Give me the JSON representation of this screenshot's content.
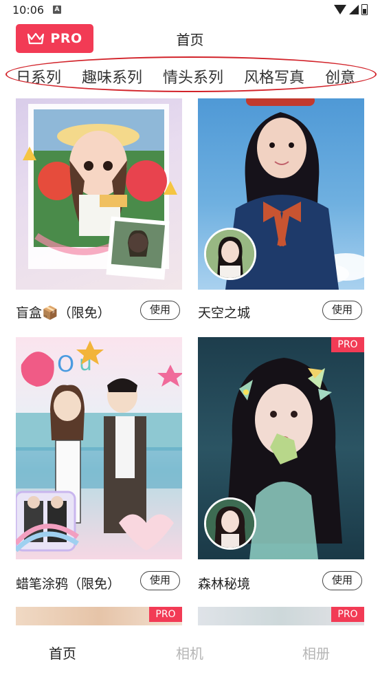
{
  "status": {
    "time": "10:06",
    "notif_icon": "A"
  },
  "header": {
    "pro_label": "PRO",
    "title": "首页"
  },
  "categories": [
    "日系列",
    "趣味系列",
    "情头系列",
    "风格写真",
    "创意"
  ],
  "cards": [
    {
      "title": "盲盒📦（限免）",
      "button": "使用"
    },
    {
      "title": "天空之城",
      "button": "使用"
    },
    {
      "title": "蜡笔涂鸦（限免）",
      "button": "使用"
    },
    {
      "title": "森林秘境",
      "button": "使用",
      "badge": "PRO"
    }
  ],
  "partial_badges": [
    "PRO",
    "PRO"
  ],
  "nav": {
    "home": "首页",
    "camera": "相机",
    "album": "相册"
  },
  "colors": {
    "accent": "#f23b55",
    "annotation": "#d2232a"
  }
}
